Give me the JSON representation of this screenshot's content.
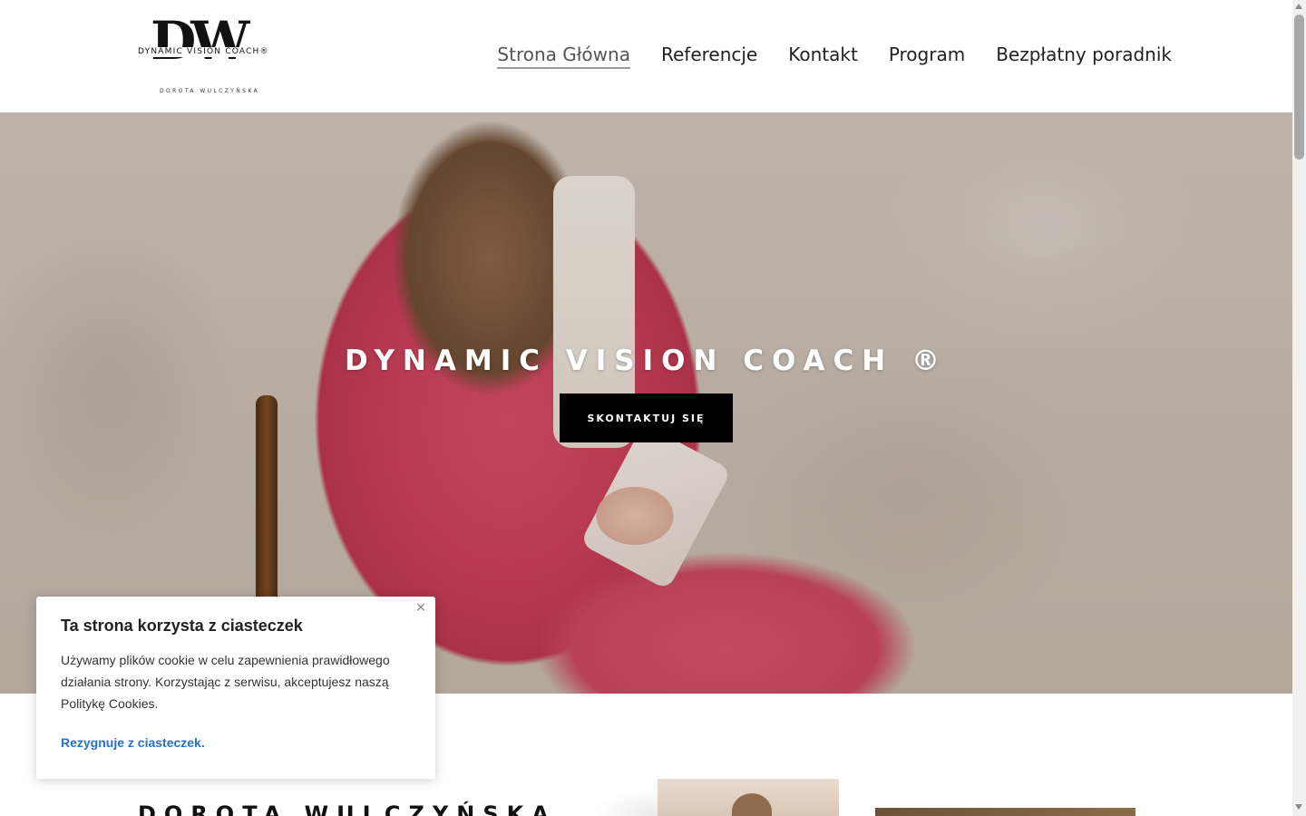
{
  "logo": {
    "monogram": "DW",
    "brand": "DYNAMIC VISION COACH®",
    "name": "DOROTA WULCZYŃSKA"
  },
  "nav": {
    "items": [
      {
        "label": "Strona Główna",
        "active": true
      },
      {
        "label": "Referencje",
        "active": false
      },
      {
        "label": "Kontakt",
        "active": false
      },
      {
        "label": "Program",
        "active": false
      },
      {
        "label": "Bezpłatny poradnik",
        "active": false
      }
    ]
  },
  "hero": {
    "title": "DYNAMIC VISION COACH ®",
    "cta_label": "SKONTAKTUJ SIĘ"
  },
  "about": {
    "title": "DOROTA WULCZYŃSKA"
  },
  "cookie": {
    "title": "Ta strona korzysta z ciasteczek",
    "text": "Używamy plików cookie w celu zapewnienia prawidłowego działania strony. Korzystając z serwisu, akceptujesz naszą Politykę Cookies.",
    "optout_label": "Rezygnuje z ciasteczek.",
    "close_icon": "×"
  },
  "colors": {
    "accent_link": "#2a6fc9",
    "button_bg": "#000000",
    "hero_suit": "#c73d58"
  }
}
